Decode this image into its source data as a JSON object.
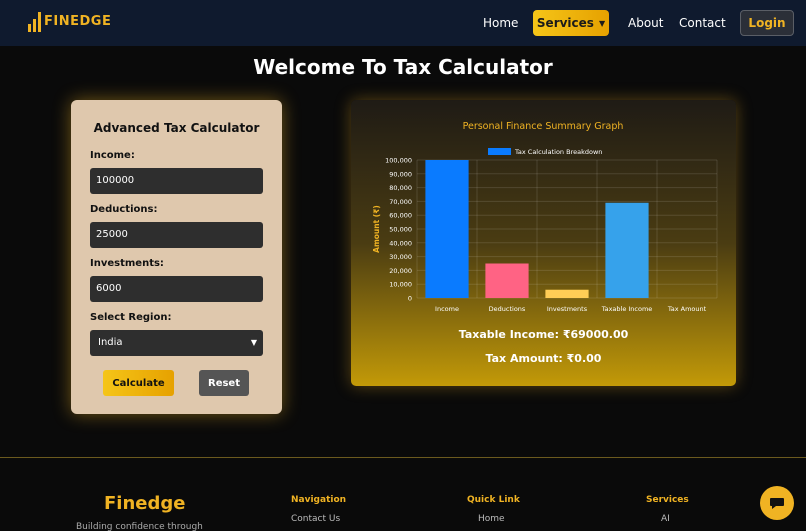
{
  "navbar": {
    "brand": "FINEDGE",
    "links": {
      "home": "Home",
      "services": "Services",
      "about": "About",
      "contact": "Contact"
    },
    "login": "Login"
  },
  "page": {
    "title": "Welcome To Tax Calculator"
  },
  "calculator": {
    "title": "Advanced Tax Calculator",
    "income_label": "Income:",
    "income_value": "100000",
    "deductions_label": "Deductions:",
    "deductions_value": "25000",
    "investments_label": "Investments:",
    "investments_value": "6000",
    "region_label": "Select Region:",
    "region_value": "India",
    "calculate_label": "Calculate",
    "reset_label": "Reset"
  },
  "chart_data": {
    "type": "bar",
    "title": "Personal Finance Summary Graph",
    "legend": "Tax Calculation Breakdown",
    "ylabel": "Amount (₹)",
    "categories": [
      "Income",
      "Deductions",
      "Investments",
      "Taxable Income",
      "Tax Amount"
    ],
    "values": [
      100000,
      25000,
      6000,
      69000,
      0
    ],
    "colors": [
      "#0a7bff",
      "#ff6384",
      "#ffcd56",
      "#36a2eb",
      "#4bc0c0"
    ],
    "ylim": [
      0,
      100000
    ],
    "yticks": [
      "0",
      "10,000",
      "20,000",
      "30,000",
      "40,000",
      "50,000",
      "60,000",
      "70,000",
      "80,000",
      "90,000",
      "100,000"
    ],
    "title_color": "#f0b323",
    "legend_position": "top",
    "grid": true
  },
  "summary": {
    "taxable_income": "Taxable Income: ₹69000.00",
    "tax_amount": "Tax Amount: ₹0.00"
  },
  "footer": {
    "brand": "Finedge",
    "tagline": "Building confidence through",
    "navigation_heading": "Navigation",
    "navigation_first": "Contact Us",
    "quicklink_heading": "Quick Link",
    "quicklink_first": "Home",
    "services_heading": "Services",
    "services_first": "AI"
  },
  "colors": {
    "accent": "#f0b323",
    "nav_bg": "#0f1a2e",
    "card_bg": "#dfc8ad"
  }
}
